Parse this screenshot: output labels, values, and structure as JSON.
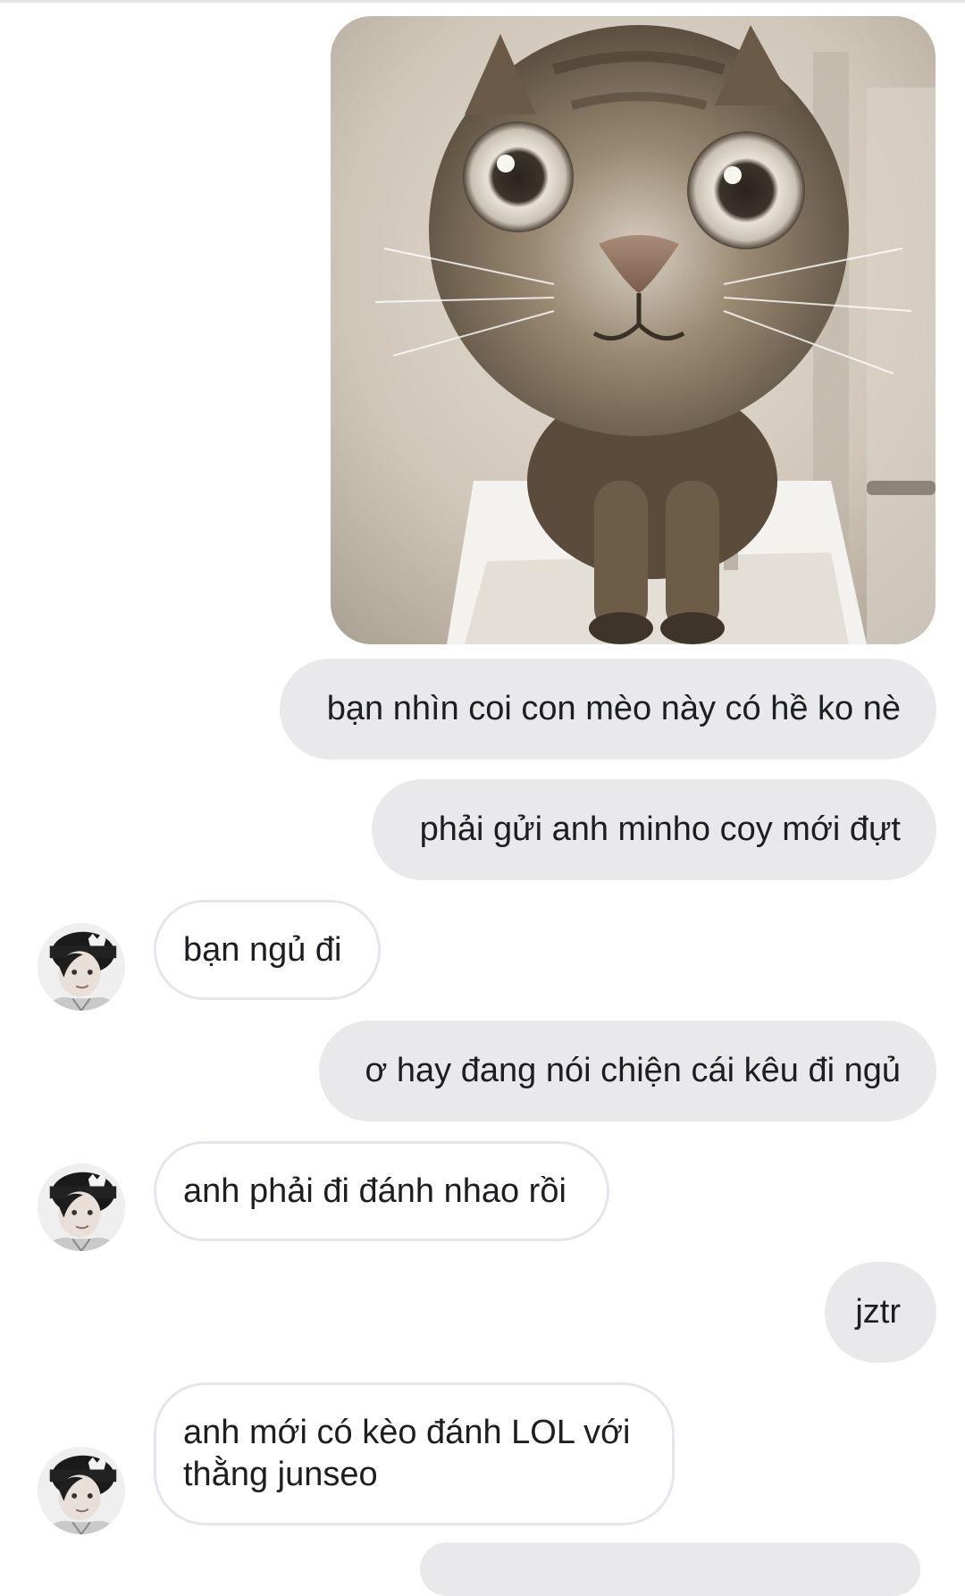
{
  "conversation": {
    "messages": [
      {
        "sender": "me",
        "type": "image",
        "image": "cat-closeup-photo"
      },
      {
        "sender": "me",
        "type": "text",
        "text": "bạn nhìn coi con mèo này có hề ko nè"
      },
      {
        "sender": "me",
        "type": "text",
        "text": "phải gửi anh minho coy mới đựt"
      },
      {
        "sender": "other",
        "type": "text",
        "text": "bạn ngủ đi"
      },
      {
        "sender": "me",
        "type": "text",
        "text": "ơ hay đang nói chiện cái kêu đi ngủ"
      },
      {
        "sender": "other",
        "type": "text",
        "text": "anh phải đi đánh nhao rồi"
      },
      {
        "sender": "me",
        "type": "text",
        "text": "jztr"
      },
      {
        "sender": "other",
        "type": "text",
        "text": "anh mới có kèo đánh LOL với thằng junseo"
      }
    ]
  },
  "colors": {
    "sent_bubble": "#e9e9eb",
    "received_bubble_border": "#e4e6eb",
    "text": "#1c1e21",
    "background": "#ffffff"
  },
  "icons": {
    "contact_avatar": "avatar-photo"
  }
}
